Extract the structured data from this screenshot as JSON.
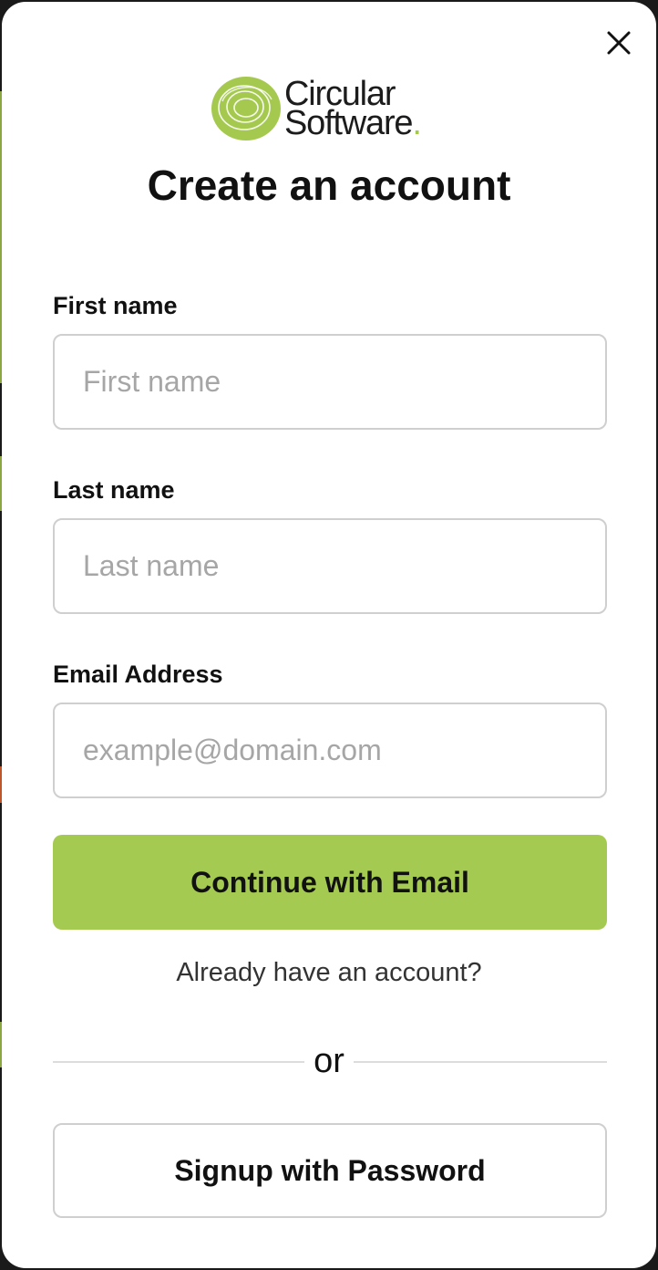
{
  "brand": {
    "line1": "Circular",
    "line2": "Software",
    "dot": ".",
    "accent": "#a5c94f"
  },
  "title": "Create an account",
  "close_icon": "close-icon",
  "fields": {
    "first_name": {
      "label": "First name",
      "placeholder": "First name",
      "value": ""
    },
    "last_name": {
      "label": "Last name",
      "placeholder": "Last name",
      "value": ""
    },
    "email": {
      "label": "Email Address",
      "placeholder": "example@domain.com",
      "value": ""
    }
  },
  "primary_button": {
    "label": "Continue with Email",
    "color": "#a5ca51"
  },
  "account_link": "Already have an account?",
  "divider": "or",
  "secondary_button": {
    "label": "Signup with Password"
  }
}
